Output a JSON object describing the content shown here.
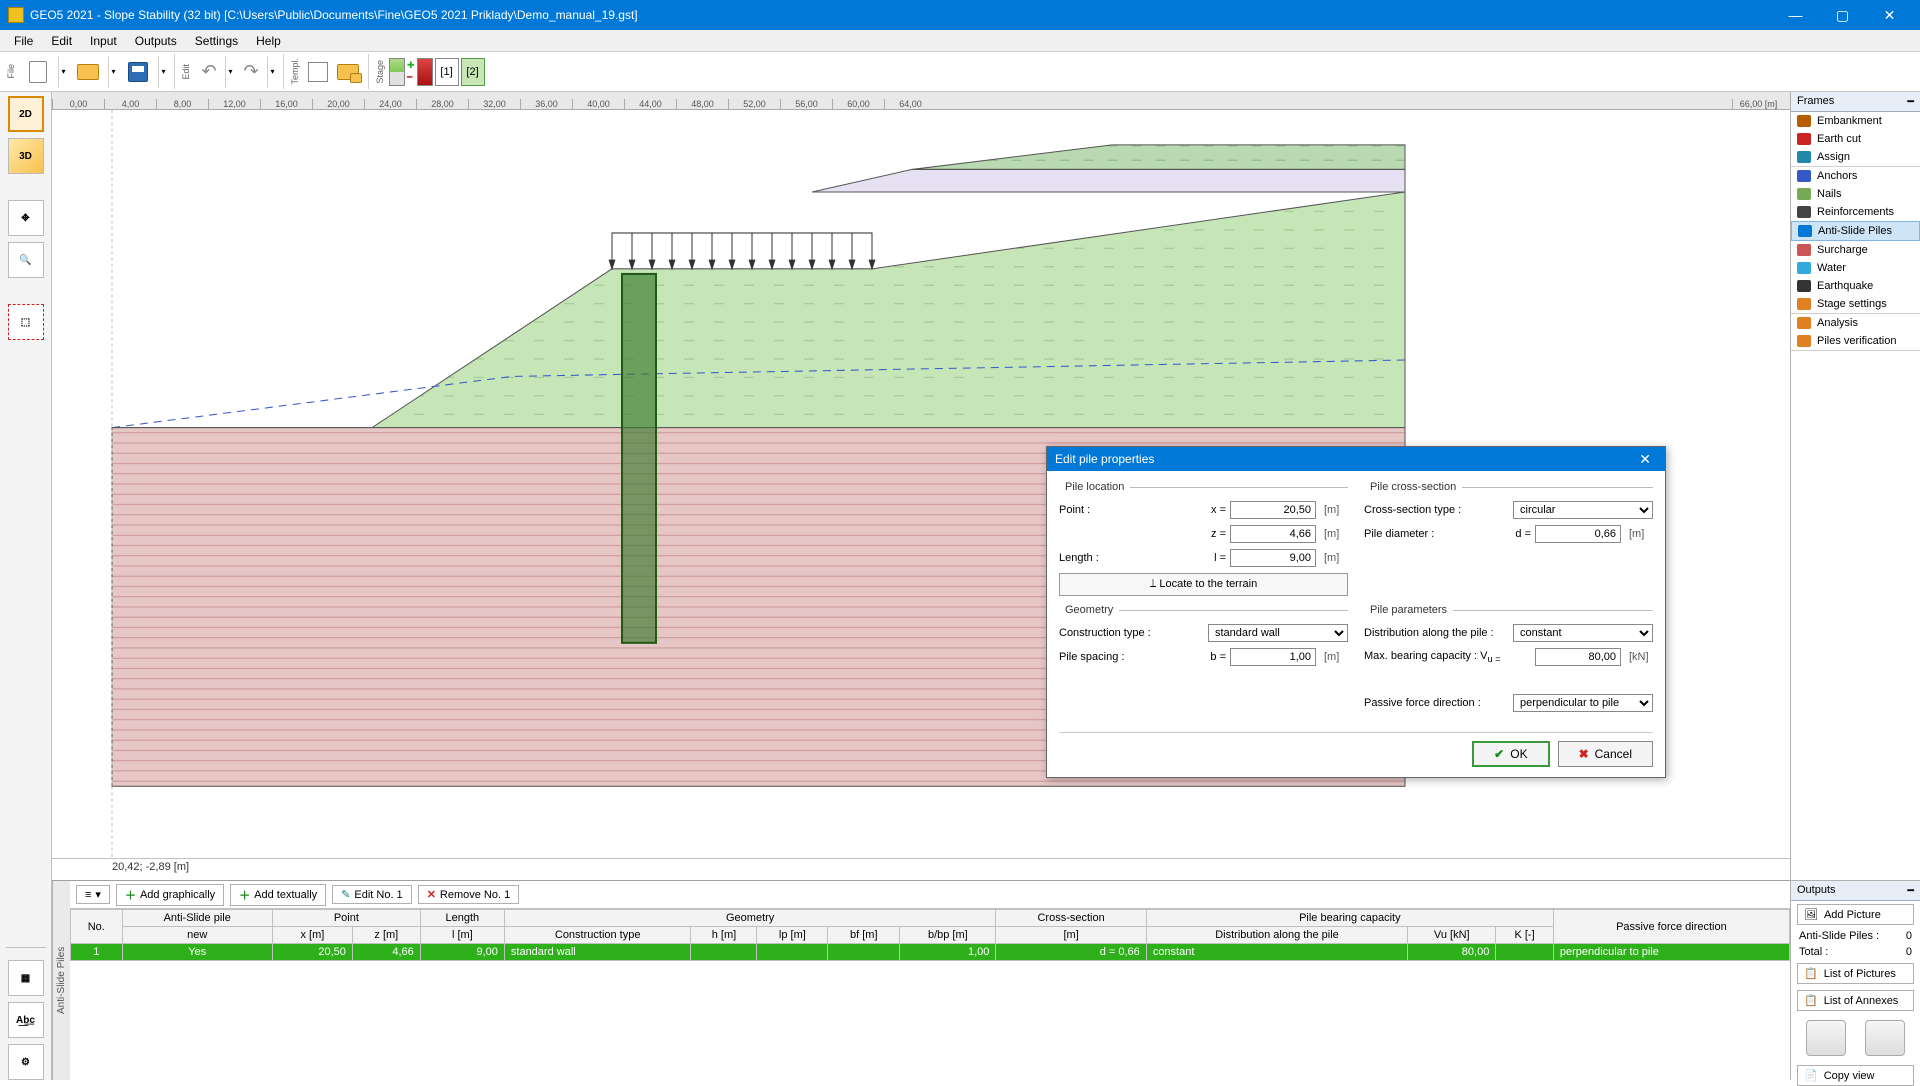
{
  "titlebar": {
    "text": "GEO5 2021 - Slope Stability (32 bit) [C:\\Users\\Public\\Documents\\Fine\\GEO5 2021 Priklady\\Demo_manual_19.gst]"
  },
  "menu": [
    "File",
    "Edit",
    "Input",
    "Outputs",
    "Settings",
    "Help"
  ],
  "stages": {
    "label1": "[1]",
    "label2": "[2]"
  },
  "ruler": [
    "0,00",
    "4,00",
    "8,00",
    "12,00",
    "16,00",
    "20,00",
    "24,00",
    "28,00",
    "32,00",
    "36,00",
    "40,00",
    "44,00",
    "48,00",
    "52,00",
    "56,00",
    "60,00",
    "64,00"
  ],
  "ruler_unit": "66,00 [m]",
  "status": "20,42; -2,89 [m]",
  "left_tabs": {
    "v2d": "2D",
    "v3d": "3D"
  },
  "frames": {
    "header": "Frames",
    "groups": [
      {
        "items": [
          {
            "key": "embankment",
            "label": "Embankment",
            "color": "#b85c00"
          },
          {
            "key": "earth-cut",
            "label": "Earth cut",
            "color": "#cc2222"
          },
          {
            "key": "assign",
            "label": "Assign",
            "color": "#28a"
          }
        ]
      },
      {
        "items": [
          {
            "key": "anchors",
            "label": "Anchors",
            "color": "#3558c7"
          },
          {
            "key": "nails",
            "label": "Nails",
            "color": "#7a5"
          },
          {
            "key": "reinforcements",
            "label": "Reinforcements",
            "color": "#444"
          },
          {
            "key": "anti-slide-piles",
            "label": "Anti-Slide Piles",
            "color": "#0078d7",
            "selected": true
          },
          {
            "key": "surcharge",
            "label": "Surcharge",
            "color": "#c55"
          },
          {
            "key": "water",
            "label": "Water",
            "color": "#3ad"
          },
          {
            "key": "earthquake",
            "label": "Earthquake",
            "color": "#333"
          },
          {
            "key": "stage-settings",
            "label": "Stage settings",
            "color": "#e08020"
          }
        ]
      },
      {
        "items": [
          {
            "key": "analysis",
            "label": "Analysis",
            "color": "#e08020"
          },
          {
            "key": "piles-verification",
            "label": "Piles verification",
            "color": "#e08020"
          }
        ]
      }
    ]
  },
  "bottom_toolbar": {
    "menu": "≡",
    "add_graphically": "Add graphically",
    "add_textually": "Add textually",
    "edit": "Edit No. 1",
    "remove": "Remove No. 1",
    "side_tab": "Anti-Slide Piles"
  },
  "table": {
    "headers_top": [
      "No.",
      "Anti-Slide pile",
      "Point",
      "",
      "Length",
      "Geometry",
      "",
      "",
      "",
      "Cross-section",
      "Pile bearing capacity",
      "",
      "",
      "Passive force direction"
    ],
    "headers_sub": [
      "",
      "new",
      "x [m]",
      "z [m]",
      "l [m]",
      "Construction type",
      "h [m]",
      "lp [m]",
      "bf [m]",
      "b/bp [m]",
      "[m]",
      "Distribution along the pile",
      "Vu [kN]",
      "K [-]",
      ""
    ],
    "row": {
      "no": "1",
      "new": "Yes",
      "x": "20,50",
      "z": "4,66",
      "l": "9,00",
      "ctype": "standard wall",
      "h": "",
      "lp": "",
      "bf": "",
      "bb": "1,00",
      "cs": "d = 0,66",
      "dist": "constant",
      "vu": "80,00",
      "k": "",
      "pfd": "perpendicular to pile"
    }
  },
  "outputs": {
    "header": "Outputs",
    "add_picture": "Add Picture",
    "rows": [
      {
        "label": "Anti-Slide Piles :",
        "value": "0"
      },
      {
        "label": "Total :",
        "value": "0"
      }
    ],
    "list_pictures": "List of Pictures",
    "list_annexes": "List of Annexes",
    "copy_view": "Copy view"
  },
  "dialog": {
    "title": "Edit pile properties",
    "loc_legend": "Pile location",
    "cs_legend": "Pile cross-section",
    "geom_legend": "Geometry",
    "param_legend": "Pile parameters",
    "point_label": "Point :",
    "x_sym": "x =",
    "x_val": "20,50",
    "m": "[m]",
    "z_sym": "z =",
    "z_val": "4,66",
    "len_label": "Length :",
    "l_sym": "l =",
    "l_val": "9,00",
    "locate": "⟘  Locate to the terrain",
    "ctype_label": "Construction type :",
    "ctype_val": "standard wall",
    "spacing_label": "Pile spacing :",
    "b_sym": "b =",
    "b_val": "1,00",
    "cst_label": "Cross-section type :",
    "cst_val": "circular",
    "dia_label": "Pile diameter :",
    "d_sym": "d =",
    "d_val": "0,66",
    "dist_label": "Distribution along the pile :",
    "dist_val": "constant",
    "cap_label": "Max. bearing capacity : V",
    "v_sym": "u =",
    "cap_val": "80,00",
    "kn": "[kN]",
    "pfd_label": "Passive force direction :",
    "pfd_val": "perpendicular to pile",
    "ok": "OK",
    "cancel": "Cancel"
  }
}
